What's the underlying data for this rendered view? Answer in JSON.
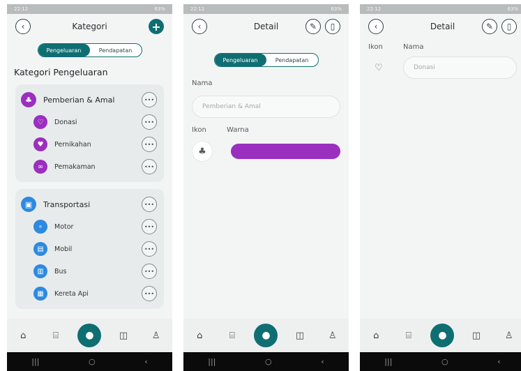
{
  "status": {
    "time": "22:12",
    "battery": "63%"
  },
  "screen1": {
    "title": "Kategori",
    "tabs": [
      "Pengeluaran",
      "Pendapatan"
    ],
    "section_title": "Kategori Pengeluaran",
    "groups": [
      {
        "name": "Pemberian & Amal",
        "icon": "charity-icon",
        "color": "#9b2fc0",
        "items": [
          {
            "name": "Donasi",
            "icon": "donation-icon"
          },
          {
            "name": "Pernikahan",
            "icon": "heart-icon"
          },
          {
            "name": "Pemakaman",
            "icon": "infinity-icon"
          }
        ]
      },
      {
        "name": "Transportasi",
        "icon": "bus-icon",
        "color": "#2d8ae0",
        "items": [
          {
            "name": "Motor",
            "icon": "motorcycle-icon"
          },
          {
            "name": "Mobil",
            "icon": "car-icon"
          },
          {
            "name": "Bus",
            "icon": "bus-icon"
          },
          {
            "name": "Kereta Api",
            "icon": "train-icon"
          }
        ]
      }
    ]
  },
  "screen2": {
    "title": "Detail",
    "tabs": [
      "Pengeluaran",
      "Pendapatan"
    ],
    "name_label": "Nama",
    "name_placeholder": "Pemberian & Amal",
    "icon_label": "Ikon",
    "color_label": "Warna",
    "color_value": "#9b2fc0"
  },
  "screen3": {
    "title": "Detail",
    "icon_label": "Ikon",
    "name_label": "Nama",
    "name_placeholder": "Donasi"
  },
  "colors": {
    "accent": "#0f6e72",
    "purple": "#9b2fc0",
    "blue": "#2d8ae0"
  }
}
